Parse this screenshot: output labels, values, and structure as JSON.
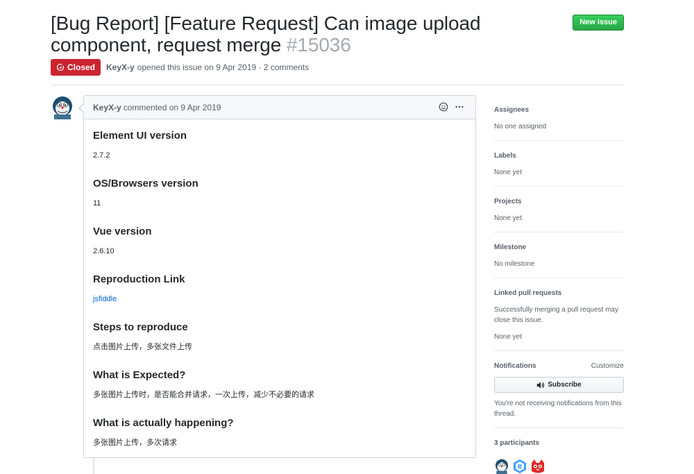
{
  "issue": {
    "title": "[Bug Report] [Feature Request] Can image upload component, request merge",
    "number": "#15036",
    "new_issue_label": "New issue",
    "state": "Closed",
    "author": "KeyX-y",
    "opened_text": "opened this issue on 9 Apr 2019 · 2 comments"
  },
  "comment": {
    "author": "KeyX-y",
    "commented_text": "commented on 9 Apr 2019",
    "sections": [
      {
        "heading": "Element UI version",
        "value": "2.7.2"
      },
      {
        "heading": "OS/Browsers version",
        "value": "11"
      },
      {
        "heading": "Vue version",
        "value": "2.6.10"
      },
      {
        "heading": "Reproduction Link",
        "value": "jsfiddle"
      },
      {
        "heading": "Steps to reproduce",
        "value": "点击图片上传，多张文件上传"
      },
      {
        "heading": "What is Expected?",
        "value": "多张图片上传时，是否能合并请求，一次上传，减少不必要的请求"
      },
      {
        "heading": "What is actually happening?",
        "value": "多张图片上传，多次请求"
      }
    ]
  },
  "sidebar": {
    "assignees": {
      "label": "Assignees",
      "value": "No one assigned"
    },
    "labels": {
      "label": "Labels",
      "value": "None yet"
    },
    "projects": {
      "label": "Projects",
      "value": "None yet"
    },
    "milestone": {
      "label": "Milestone",
      "value": "No milestone"
    },
    "linked": {
      "label": "Linked pull requests",
      "note": "Successfully merging a pull request may close this issue.",
      "value": "None yet"
    },
    "notifications": {
      "label": "Notifications",
      "customize": "Customize",
      "subscribe": "Subscribe",
      "note": "You're not receiving notifications from this thread."
    },
    "participants": {
      "label": "3 participants"
    }
  },
  "colors": {
    "closed": "#cb2431",
    "new_issue": "#2cbe4e",
    "link": "#0366d6"
  }
}
